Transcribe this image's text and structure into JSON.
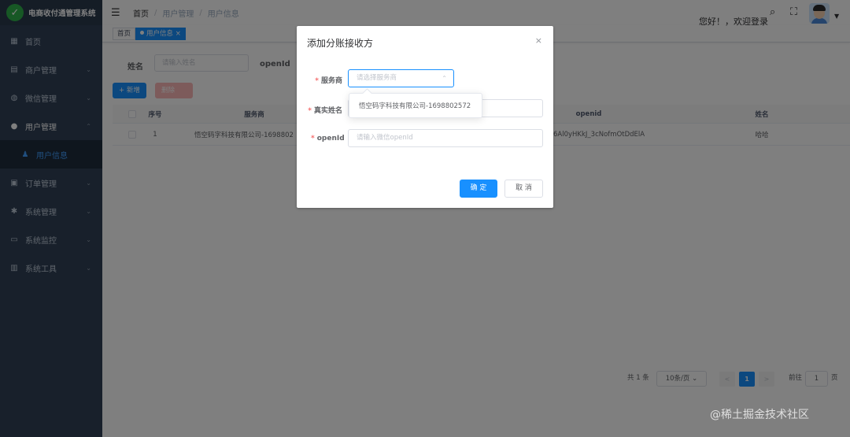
{
  "app": {
    "title": "电商收付通管理系统",
    "logo_glyph": "✓"
  },
  "sidebar": {
    "items": [
      {
        "label": "首页",
        "icon": "dashboard-icon"
      },
      {
        "label": "商户管理",
        "icon": "shop-icon"
      },
      {
        "label": "微信管理",
        "icon": "wechat-icon"
      },
      {
        "label": "用户管理",
        "icon": "user-icon"
      },
      {
        "label": "用户信息",
        "icon": "user-group-icon"
      },
      {
        "label": "订单管理",
        "icon": "order-icon"
      },
      {
        "label": "系统管理",
        "icon": "gear-icon"
      },
      {
        "label": "系统监控",
        "icon": "monitor-icon"
      },
      {
        "label": "系统工具",
        "icon": "toolbox-icon"
      }
    ]
  },
  "navbar": {
    "breadcrumb": [
      "首页",
      "用户管理",
      "用户信息"
    ],
    "separator": "/",
    "greeting": "您好！，欢迎登录"
  },
  "tags": {
    "home": "首页",
    "active": "用户信息",
    "close": "×"
  },
  "search": {
    "name_label": "姓名",
    "name_placeholder": "请输入姓名",
    "openid_label": "openId"
  },
  "toolbar": {
    "add_label": "+ 新增",
    "delete_label": "删除"
  },
  "table": {
    "columns": [
      "序号",
      "服务商",
      "openid",
      "姓名"
    ],
    "rows": [
      {
        "index": "1",
        "provider": "悟空码字科技有限公司-1698802",
        "openid": "6Al0yHKkJ_3cNofmOtDdElA",
        "name": "哈哈"
      }
    ]
  },
  "pagination": {
    "total": "共 1 条",
    "page_size": "10条/页",
    "prev": "<",
    "current": "1",
    "next": ">",
    "goto_label": "前往",
    "goto_value": "1",
    "page_suffix": "页"
  },
  "dialog": {
    "title": "添加分账接收方",
    "close": "×",
    "fields": [
      {
        "label": "服务商",
        "placeholder": "请选择服务商"
      },
      {
        "label": "真实姓名",
        "placeholder": ""
      },
      {
        "label": "openId",
        "placeholder": "请输入微信openId"
      }
    ],
    "required_mark": "*",
    "ok_label": "确 定",
    "cancel_label": "取 消"
  },
  "dropdown": {
    "options": [
      "悟空码字科技有限公司-1698802572"
    ]
  },
  "watermark": "@稀土掘金技术社区",
  "colors": {
    "sidebar_bg": "#304156",
    "primary": "#1890ff",
    "required": "#f56c6c",
    "logo": "#2fb14a"
  }
}
